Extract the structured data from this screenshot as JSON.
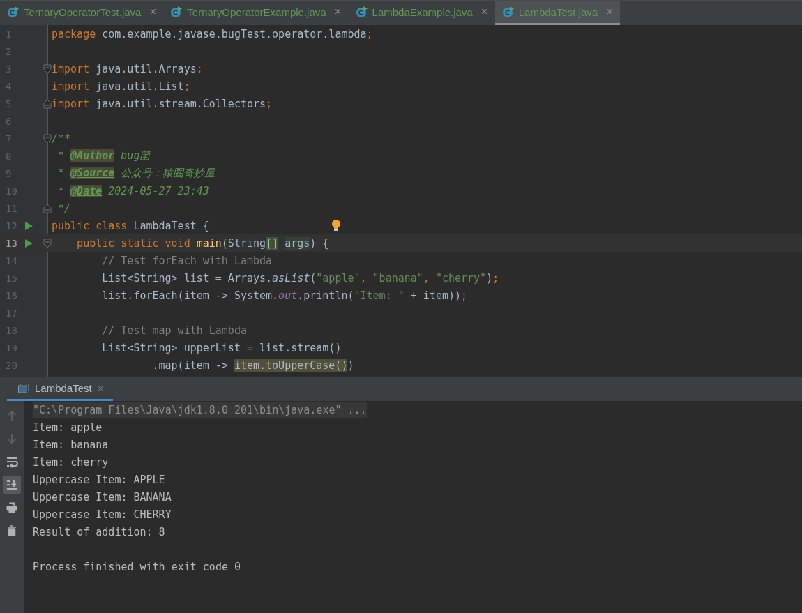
{
  "editor_tabs": [
    {
      "label": "TernaryOperatorTest.java",
      "close": "×",
      "selected": false
    },
    {
      "label": "TernaryOperatorExample.java",
      "close": "×",
      "selected": false
    },
    {
      "label": "LambdaExample.java",
      "close": "×",
      "selected": false
    },
    {
      "label": "LambdaTest.java",
      "close": "×",
      "selected": true
    }
  ],
  "code_lines": [
    {
      "number": "1",
      "run": false,
      "fold_start": false,
      "fold_end": false,
      "current": false,
      "bulb": false,
      "tokens": [
        {
          "kind": "keyword",
          "text": "package"
        },
        {
          "kind": "plain",
          "text": " com.example.javase.bugTest.operator.lambda"
        },
        {
          "kind": "keyword",
          "text": ";"
        }
      ]
    },
    {
      "number": "2",
      "run": false,
      "fold_start": false,
      "fold_end": false,
      "current": false,
      "bulb": false
    },
    {
      "number": "3",
      "run": false,
      "fold_start": true,
      "fold_end": false,
      "current": false,
      "bulb": false,
      "tokens": [
        {
          "kind": "keyword",
          "text": "import"
        },
        {
          "kind": "plain",
          "text": " java.util.Arrays"
        },
        {
          "kind": "keyword",
          "text": ";"
        }
      ]
    },
    {
      "number": "4",
      "run": false,
      "fold_start": false,
      "fold_end": false,
      "current": false,
      "bulb": false,
      "tokens": [
        {
          "kind": "keyword",
          "text": "import"
        },
        {
          "kind": "plain",
          "text": " java.util.List"
        },
        {
          "kind": "keyword",
          "text": ";"
        }
      ]
    },
    {
      "number": "5",
      "run": false,
      "fold_start": false,
      "fold_end": true,
      "current": false,
      "bulb": false,
      "tokens": [
        {
          "kind": "keyword",
          "text": "import"
        },
        {
          "kind": "plain",
          "text": " java.util.stream.Collectors"
        },
        {
          "kind": "keyword",
          "text": ";"
        }
      ]
    },
    {
      "number": "6",
      "run": false,
      "fold_start": false,
      "fold_end": false,
      "current": false,
      "bulb": false
    },
    {
      "number": "7",
      "run": false,
      "fold_start": true,
      "fold_end": false,
      "current": false,
      "bulb": false,
      "tokens": [
        {
          "kind": "doc",
          "text": "/**"
        }
      ]
    },
    {
      "number": "8",
      "run": false,
      "fold_start": false,
      "fold_end": false,
      "current": false,
      "bulb": false,
      "tokens": [
        {
          "kind": "doc",
          "text": " * "
        },
        {
          "kind": "doctag",
          "text": "@Author"
        },
        {
          "kind": "doc",
          "text": " bug菌"
        }
      ]
    },
    {
      "number": "9",
      "run": false,
      "fold_start": false,
      "fold_end": false,
      "current": false,
      "bulb": false,
      "tokens": [
        {
          "kind": "doc",
          "text": " * "
        },
        {
          "kind": "doctag",
          "text": "@Source"
        },
        {
          "kind": "doc",
          "text": " 公众号：猿圈奇妙屋"
        }
      ]
    },
    {
      "number": "10",
      "run": false,
      "fold_start": false,
      "fold_end": false,
      "current": false,
      "bulb": false,
      "tokens": [
        {
          "kind": "doc",
          "text": " * "
        },
        {
          "kind": "doctag",
          "text": "@Date"
        },
        {
          "kind": "doc",
          "text": " 2024-05-27 23:43"
        }
      ]
    },
    {
      "number": "11",
      "run": false,
      "fold_start": false,
      "fold_end": true,
      "current": false,
      "bulb": false,
      "tokens": [
        {
          "kind": "doc",
          "text": " */"
        }
      ]
    },
    {
      "number": "12",
      "run": true,
      "fold_start": false,
      "fold_end": false,
      "current": false,
      "bulb": true,
      "tokens": [
        {
          "kind": "keyword",
          "text": "public class"
        },
        {
          "kind": "plain",
          "text": " LambdaTest {"
        }
      ]
    },
    {
      "number": "13",
      "run": true,
      "fold_start": true,
      "fold_end": false,
      "current": true,
      "bulb": false,
      "tokens": [
        {
          "kind": "keyword",
          "text": "    public static void "
        },
        {
          "kind": "method",
          "text": "main"
        },
        {
          "kind": "plain",
          "text": "(String"
        },
        {
          "kind": "brace",
          "text": "[]"
        },
        {
          "kind": "param",
          "text": "args",
          "space_before": true
        },
        {
          "kind": "plain",
          "text": ") {"
        }
      ]
    },
    {
      "number": "14",
      "run": false,
      "fold_start": false,
      "fold_end": false,
      "current": false,
      "bulb": false,
      "tokens": [
        {
          "kind": "comment",
          "text": "        // Test forEach with Lambda"
        }
      ]
    },
    {
      "number": "15",
      "run": false,
      "fold_start": false,
      "fold_end": false,
      "current": false,
      "bulb": false,
      "tokens": [
        {
          "kind": "plain",
          "text": "        List<String> list = Arrays."
        },
        {
          "kind": "italic",
          "text": "asList"
        },
        {
          "kind": "plain",
          "text": "("
        },
        {
          "kind": "string",
          "text": "\"apple\""
        },
        {
          "kind": "keyword",
          "text": ", "
        },
        {
          "kind": "string",
          "text": "\"banana\""
        },
        {
          "kind": "keyword",
          "text": ", "
        },
        {
          "kind": "string",
          "text": "\"cherry\""
        },
        {
          "kind": "plain",
          "text": ")"
        },
        {
          "kind": "keyword",
          "text": ";"
        }
      ]
    },
    {
      "number": "16",
      "run": false,
      "fold_start": false,
      "fold_end": false,
      "current": false,
      "bulb": false,
      "tokens": [
        {
          "kind": "plain",
          "text": "        list.forEach(item -> System."
        },
        {
          "kind": "static",
          "text": "out"
        },
        {
          "kind": "plain",
          "text": ".println("
        },
        {
          "kind": "string",
          "text": "\"Item: \""
        },
        {
          "kind": "plain",
          "text": " + item))"
        },
        {
          "kind": "keyword",
          "text": ";"
        }
      ]
    },
    {
      "number": "17",
      "run": false,
      "fold_start": false,
      "fold_end": false,
      "current": false,
      "bulb": false
    },
    {
      "number": "18",
      "run": false,
      "fold_start": false,
      "fold_end": false,
      "current": false,
      "bulb": false,
      "tokens": [
        {
          "kind": "comment",
          "text": "        // Test map with Lambda"
        }
      ]
    },
    {
      "number": "19",
      "run": false,
      "fold_start": false,
      "fold_end": false,
      "current": false,
      "bulb": false,
      "tokens": [
        {
          "kind": "plain",
          "text": "        List<String> upperList = list.stream()"
        }
      ]
    },
    {
      "number": "20",
      "run": false,
      "fold_start": false,
      "fold_end": false,
      "current": false,
      "bulb": false,
      "tokens": [
        {
          "kind": "plain",
          "text": "                .map(item -> "
        },
        {
          "kind": "highlight",
          "text": "item.toUpperCase()"
        },
        {
          "kind": "plain",
          "text": ")"
        }
      ]
    }
  ],
  "console": {
    "tab": {
      "label": "LambdaTest",
      "close": "×",
      "selected": true
    },
    "tools": [
      {
        "kind": "up",
        "disabled": true,
        "selected": false
      },
      {
        "kind": "down",
        "disabled": true,
        "selected": false
      },
      {
        "kind": "wrap",
        "disabled": false,
        "selected": false
      },
      {
        "kind": "scroll-end",
        "disabled": false,
        "selected": true
      },
      {
        "kind": "print",
        "disabled": false,
        "selected": false
      },
      {
        "kind": "clear",
        "disabled": false,
        "selected": false
      }
    ],
    "lines": [
      {
        "kind": "command",
        "text": "\"C:\\Program Files\\Java\\jdk1.8.0_201\\bin\\java.exe\" ..."
      },
      {
        "kind": "output",
        "text": "Item: apple"
      },
      {
        "kind": "output",
        "text": "Item: banana"
      },
      {
        "kind": "output",
        "text": "Item: cherry"
      },
      {
        "kind": "output",
        "text": "Uppercase Item: APPLE"
      },
      {
        "kind": "output",
        "text": "Uppercase Item: BANANA"
      },
      {
        "kind": "output",
        "text": "Uppercase Item: CHERRY"
      },
      {
        "kind": "output",
        "text": "Result of addition: 8"
      },
      {
        "kind": "blank"
      },
      {
        "kind": "output",
        "text": "Process finished with exit code 0"
      }
    ]
  }
}
